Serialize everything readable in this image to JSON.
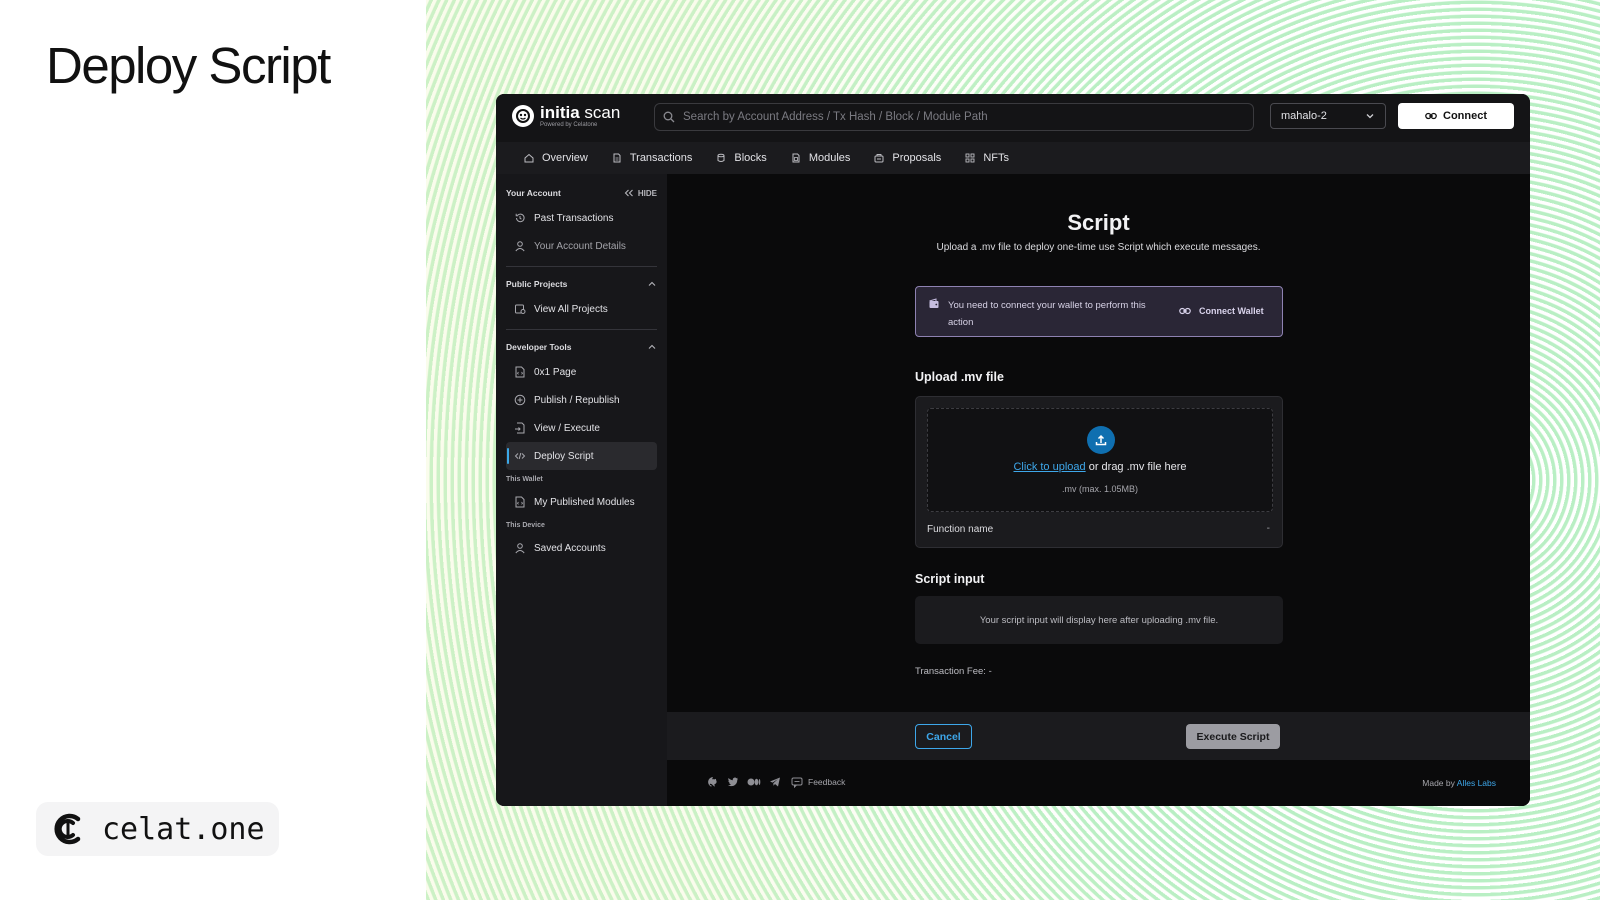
{
  "slide": {
    "title": "Deploy Script",
    "brand": "celat.one"
  },
  "app": {
    "logo_name": "initia",
    "logo_suffix": "scan",
    "logo_sub": "Powered by Celatone",
    "search_placeholder": "Search by Account Address / Tx Hash / Block / Module Path",
    "network": "mahalo-2",
    "connect_label": "Connect"
  },
  "nav": [
    {
      "label": "Overview",
      "icon": "home-icon"
    },
    {
      "label": "Transactions",
      "icon": "document-icon"
    },
    {
      "label": "Blocks",
      "icon": "blocks-icon"
    },
    {
      "label": "Modules",
      "icon": "module-icon"
    },
    {
      "label": "Proposals",
      "icon": "proposal-icon"
    },
    {
      "label": "NFTs",
      "icon": "grid-icon"
    }
  ],
  "sidebar": {
    "your_account": "Your Account",
    "hide": "HIDE",
    "past_transactions": "Past Transactions",
    "account_details": "Your Account Details",
    "public_projects": "Public Projects",
    "view_all_projects": "View All Projects",
    "developer_tools": "Developer Tools",
    "page_0x1": "0x1 Page",
    "publish": "Publish / Republish",
    "view_execute": "View / Execute",
    "deploy_script": "Deploy Script",
    "this_wallet": "This Wallet",
    "published_modules": "My Published Modules",
    "this_device": "This Device",
    "saved_accounts": "Saved Accounts"
  },
  "main": {
    "title": "Script",
    "description": "Upload a .mv file to deploy one-time use Script which execute messages.",
    "alert_text": "You need to connect your wallet to perform this action",
    "alert_button": "Connect Wallet",
    "upload_title": "Upload .mv file",
    "upload_link": "Click to upload",
    "upload_rest": " or drag .mv file here",
    "upload_hint": ".mv (max. 1.05MB)",
    "function_label": "Function name",
    "function_value": "-",
    "input_title": "Script input",
    "input_placeholder": "Your script input will display here after uploading .mv file.",
    "fee": "Transaction Fee: -",
    "cancel": "Cancel",
    "execute": "Execute Script"
  },
  "footer": {
    "feedback": "Feedback",
    "made_by": "Made by",
    "made_by_link": "Alles Labs"
  },
  "colors": {
    "accent": "#3ea7ea",
    "alert_border": "#8e82b2",
    "alert_bg": "#2a2636",
    "bg_ring": "#b9efc4"
  }
}
